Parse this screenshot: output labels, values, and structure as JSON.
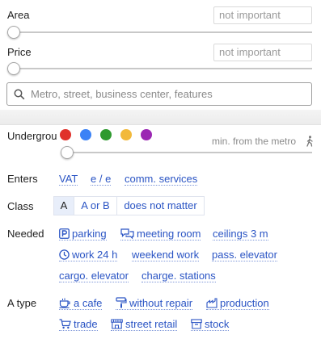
{
  "area": {
    "label": "Area",
    "placeholder": "not important",
    "level": 0
  },
  "price": {
    "label": "Price",
    "placeholder": "not important",
    "level": 0
  },
  "search": {
    "placeholder": "Metro, street, business center, features"
  },
  "underground": {
    "label": "Undergrou",
    "line_colors": [
      "#e0312b",
      "#3b82f6",
      "#2e9a2e",
      "#f2b93b",
      "#9b27b3"
    ],
    "distance_label": "min. from the metro",
    "level": 0
  },
  "enters": {
    "label": "Enters",
    "options": [
      "VAT",
      "e / e",
      "comm. services"
    ]
  },
  "class": {
    "label": "Class",
    "options": [
      "A",
      "A or B",
      "does not matter"
    ],
    "selected": "A"
  },
  "needed": {
    "label": "Needed",
    "options": [
      {
        "label": "parking",
        "icon": "parking-icon"
      },
      {
        "label": "meeting room",
        "icon": "chat-bubbles-icon"
      },
      {
        "label": "ceilings 3 m",
        "icon": ""
      },
      {
        "label": "work 24 h",
        "icon": "clock-icon"
      },
      {
        "label": "weekend work",
        "icon": ""
      },
      {
        "label": "pass. elevator",
        "icon": ""
      },
      {
        "label": "cargo. elevator",
        "icon": ""
      },
      {
        "label": "charge. stations",
        "icon": ""
      }
    ]
  },
  "type": {
    "label": "A type",
    "options": [
      {
        "label": "a cafe",
        "icon": "cup-icon"
      },
      {
        "label": "without repair",
        "icon": "paint-roller-icon"
      },
      {
        "label": "production",
        "icon": "factory-icon"
      },
      {
        "label": "trade",
        "icon": "cart-icon"
      },
      {
        "label": "street retail",
        "icon": "storefront-icon"
      },
      {
        "label": "stock",
        "icon": "box-icon"
      }
    ]
  }
}
